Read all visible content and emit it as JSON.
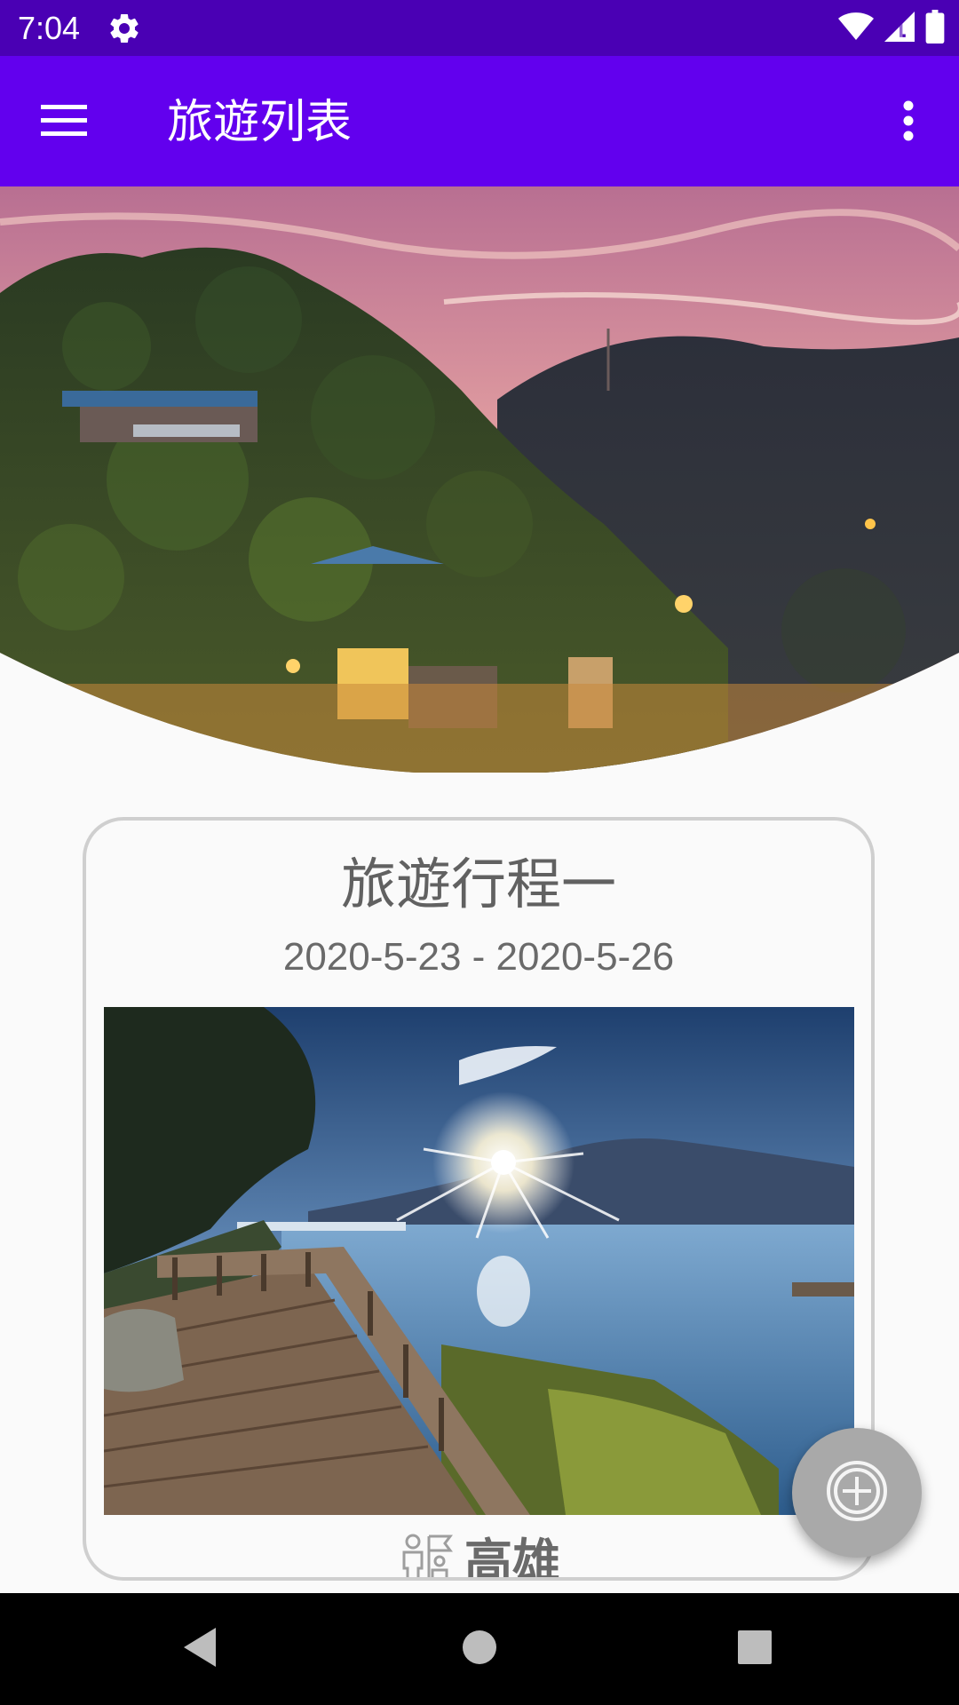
{
  "status_bar": {
    "time": "7:04",
    "icons": [
      "gear-icon",
      "wifi-icon",
      "signal-icon",
      "battery-icon"
    ],
    "background": "#4a00b4"
  },
  "app_bar": {
    "title": "旅遊列表",
    "background": "#6200ee",
    "menu_icon": "hamburger-icon",
    "overflow_icon": "more-vert-icon"
  },
  "hero": {
    "image": "sunset lake mountain village"
  },
  "trip_card": {
    "title": "旅遊行程一",
    "dates": "2020-5-23 - 2020-5-26",
    "image": "lakeside boardwalk at sunrise",
    "location_icon": "tour-guide-icon",
    "location": "高雄"
  },
  "fab": {
    "icon": "add-circle-icon",
    "color": "#a9a9a9"
  },
  "nav_bar": {
    "buttons": [
      "back-icon",
      "home-icon",
      "recents-icon"
    ]
  }
}
